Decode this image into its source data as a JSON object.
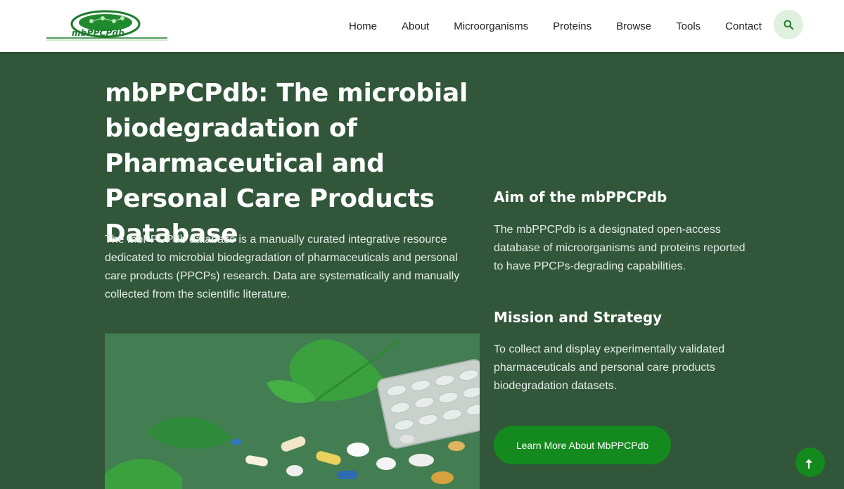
{
  "brand": {
    "logo_text": "mbPPCPdb"
  },
  "nav": {
    "items": [
      {
        "label": "Home"
      },
      {
        "label": "About"
      },
      {
        "label": "Microorganisms"
      },
      {
        "label": "Proteins"
      },
      {
        "label": "Browse"
      },
      {
        "label": "Tools"
      },
      {
        "label": "Contact"
      }
    ],
    "search_icon": "search-icon"
  },
  "hero": {
    "title": "mbPPCPdb: The microbial biodegradation of Pharmaceutical and Personal Care Products Database",
    "description": "The mbPPCPdb database is a manually curated integrative resource dedicated to microbial biodegradation of pharmaceuticals and personal care products (PPCPs) research. Data are systematically and manually collected from the scientific literature."
  },
  "aim": {
    "title": "Aim of the mbPPCPdb",
    "text": "The mbPPCPdb is a designated open-access database of microorganisms and proteins reported to have PPCPs-degrading capabilities."
  },
  "mission": {
    "title": "Mission and Strategy",
    "text": "To collect and display experimentally validated pharmaceuticals and personal care products biodegradation datasets."
  },
  "cta": {
    "label": "Learn More About MbPPCPdb"
  },
  "colors": {
    "background": "#31563a",
    "accent": "#148a1e",
    "header": "#ffffff"
  }
}
